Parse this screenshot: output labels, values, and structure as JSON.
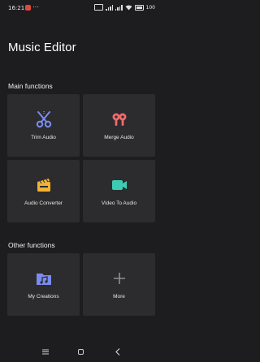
{
  "status_bar": {
    "time": "16:21",
    "dots": "···",
    "battery": "100"
  },
  "app": {
    "title": "Music Editor"
  },
  "sections": {
    "main_title": "Main functions",
    "other_title": "Other functions"
  },
  "main_functions": [
    {
      "label": "Trim Audio",
      "icon": "scissors-icon",
      "color": "#7b8cf0"
    },
    {
      "label": "Merge Audio",
      "icon": "earbuds-icon",
      "color": "#f06b6b"
    },
    {
      "label": "Audio Converter",
      "icon": "converter-icon",
      "color": "#f2b233"
    },
    {
      "label": "Video To Audio",
      "icon": "video-camera-icon",
      "color": "#3ecbb3"
    }
  ],
  "other_functions": [
    {
      "label": "My Creations",
      "icon": "music-folder-icon",
      "color": "#7b8cf0"
    },
    {
      "label": "More",
      "icon": "plus-icon",
      "color": "#8e8e93"
    }
  ],
  "colors": {
    "background": "#1d1d1f",
    "card": "#2c2c2e"
  }
}
